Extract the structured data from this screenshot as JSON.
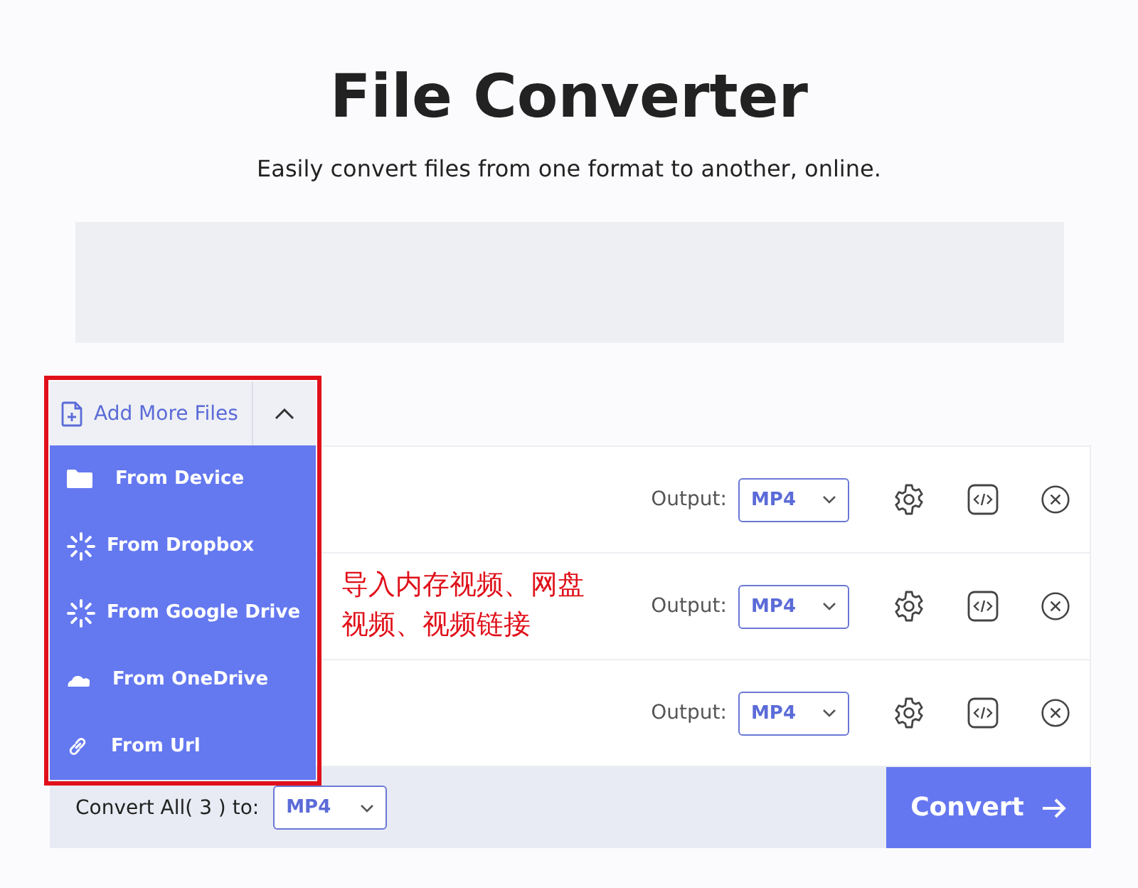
{
  "header": {
    "title": "File Converter",
    "subtitle": "Easily convert files from one format to another, online."
  },
  "add_files": {
    "label": "Add More Files",
    "expanded": true
  },
  "source_menu": [
    {
      "kind": "folder",
      "label": "From Device"
    },
    {
      "kind": "spinner",
      "label": "From Dropbox"
    },
    {
      "kind": "spinner",
      "label": "From Google Drive"
    },
    {
      "kind": "cloud",
      "label": "From OneDrive"
    },
    {
      "kind": "link",
      "label": "From Url"
    }
  ],
  "files": [
    {
      "output_label": "Output:",
      "format": "MP4"
    },
    {
      "output_label": "Output:",
      "format": "MP4"
    },
    {
      "output_label": "Output:",
      "format": "MP4"
    }
  ],
  "convert_bar": {
    "label": "Convert All( 3 ) to:",
    "format": "MP4",
    "button": "Convert"
  },
  "annotation": {
    "text": "导入内存视频、网盘视频、视频链接"
  }
}
